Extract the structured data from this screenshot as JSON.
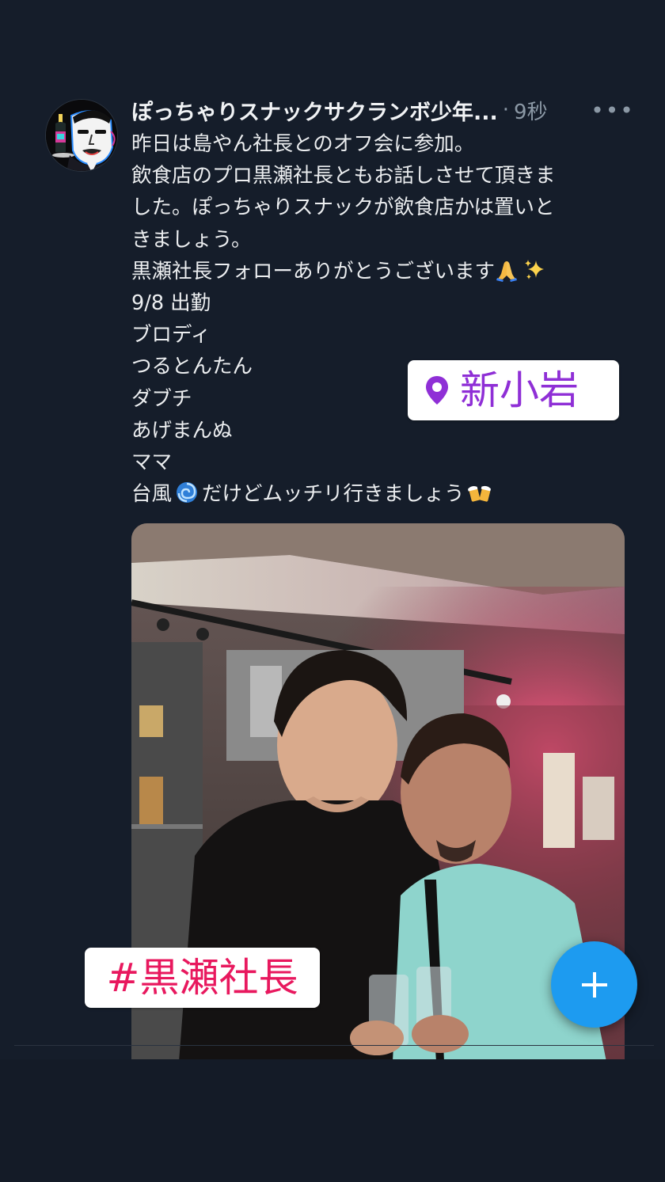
{
  "post": {
    "display_name": "ぽっちゃりスナックサクランボ少年...",
    "separator": "·",
    "timestamp": "9秒",
    "more_label": "•••",
    "lines": [
      "昨日は島やん社長とのオフ会に参加。",
      "飲食店のプロ黒瀬社長ともお話しさせて頂きま",
      "した。ぽっちゃりスナックが飲食店かは置いと",
      "きましょう。",
      "黒瀬社長フォローありがとうございます",
      "9/8 出勤",
      "ブロディ",
      "つるとんたん",
      "ダブチ",
      "あげまんぬ",
      "ママ",
      "台風",
      "だけどムッチリ行きましょう"
    ],
    "emoji": {
      "thanks": "folded-hands-icon",
      "sparkles": "sparkles-icon",
      "typhoon": "cyclone-icon",
      "beer": "beer-mugs-icon"
    }
  },
  "stickers": {
    "location": "新小岩",
    "hashtag": "#黒瀬社長"
  },
  "fab": {
    "icon": "plus-icon"
  },
  "colors": {
    "background": "#151d2a",
    "accent_blue": "#1d9bf0",
    "location_purple": "#8f2fd6",
    "hashtag_pink": "#e8185e",
    "secondary_text": "#8b98a5"
  }
}
